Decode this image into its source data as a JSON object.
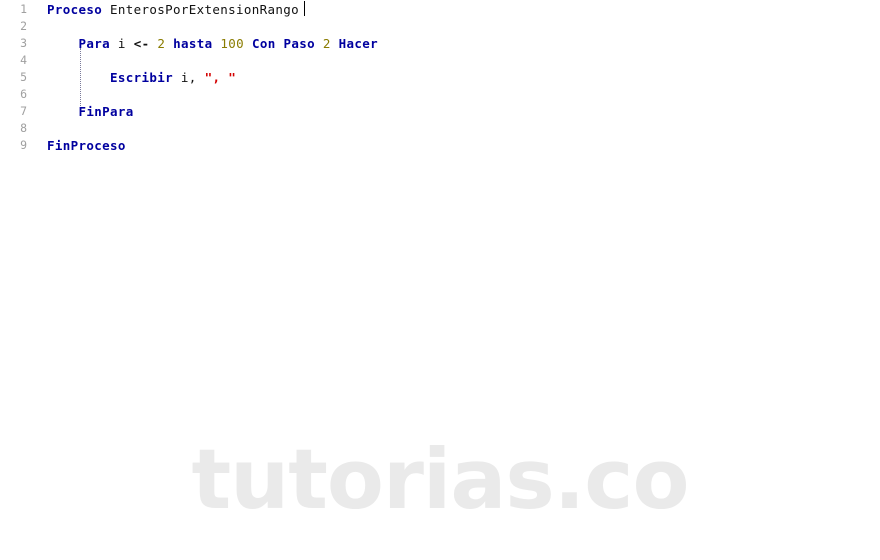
{
  "editor": {
    "background_color": "#ffffff",
    "gutter_color": "#a0a0a0",
    "keyword_color": "#00009f",
    "number_color": "#8a7c00",
    "string_color": "#d30000",
    "identifier_color": "#111111",
    "caret_visible": true,
    "indent_guide_color": "#7a7a9a"
  },
  "lines": [
    {
      "number": "1",
      "tokens": [
        {
          "text": "Proceso",
          "kind": "kw"
        },
        {
          "text": " ",
          "kind": "plain"
        },
        {
          "text": "EnterosPorExtensionRango",
          "kind": "id"
        }
      ]
    },
    {
      "number": "2",
      "tokens": []
    },
    {
      "number": "3",
      "tokens": [
        {
          "text": "    ",
          "kind": "plain"
        },
        {
          "text": "Para",
          "kind": "kw"
        },
        {
          "text": " ",
          "kind": "plain"
        },
        {
          "text": "i",
          "kind": "id"
        },
        {
          "text": " ",
          "kind": "plain"
        },
        {
          "text": "<-",
          "kind": "op"
        },
        {
          "text": " ",
          "kind": "plain"
        },
        {
          "text": "2",
          "kind": "num"
        },
        {
          "text": " ",
          "kind": "plain"
        },
        {
          "text": "hasta",
          "kind": "kw"
        },
        {
          "text": " ",
          "kind": "plain"
        },
        {
          "text": "100",
          "kind": "num"
        },
        {
          "text": " ",
          "kind": "plain"
        },
        {
          "text": "Con",
          "kind": "kw"
        },
        {
          "text": " ",
          "kind": "plain"
        },
        {
          "text": "Paso",
          "kind": "kw"
        },
        {
          "text": " ",
          "kind": "plain"
        },
        {
          "text": "2",
          "kind": "num"
        },
        {
          "text": " ",
          "kind": "plain"
        },
        {
          "text": "Hacer",
          "kind": "kw"
        }
      ]
    },
    {
      "number": "4",
      "tokens": []
    },
    {
      "number": "5",
      "tokens": [
        {
          "text": "        ",
          "kind": "plain"
        },
        {
          "text": "Escribir",
          "kind": "kw"
        },
        {
          "text": " ",
          "kind": "plain"
        },
        {
          "text": "i,",
          "kind": "id"
        },
        {
          "text": " ",
          "kind": "plain"
        },
        {
          "text": "\", \"",
          "kind": "str"
        }
      ]
    },
    {
      "number": "6",
      "tokens": []
    },
    {
      "number": "7",
      "tokens": [
        {
          "text": "    ",
          "kind": "plain"
        },
        {
          "text": "FinPara",
          "kind": "kw"
        }
      ]
    },
    {
      "number": "8",
      "tokens": []
    },
    {
      "number": "9",
      "tokens": [
        {
          "text": "FinProceso",
          "kind": "kw"
        }
      ]
    }
  ],
  "watermark": {
    "text": "tutorias.co",
    "color": "#eaeaea"
  }
}
